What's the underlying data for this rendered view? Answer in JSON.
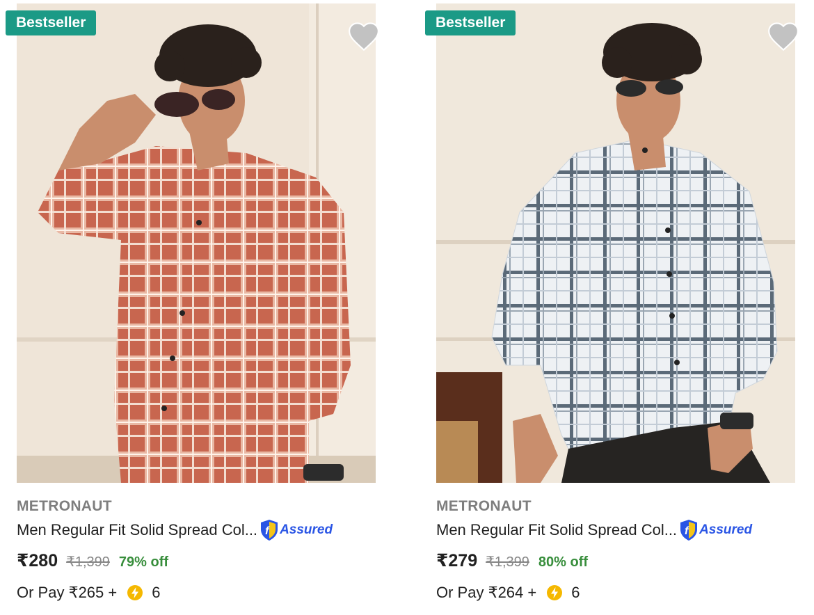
{
  "products": [
    {
      "badge": "Bestseller",
      "brand": "METRONAUT",
      "title": "Men Regular Fit Solid Spread Col...",
      "assured": "Assured",
      "price": "₹280",
      "mrp": "₹1,399",
      "discount": "79% off",
      "pay_prefix": "Or Pay ₹265 +",
      "coins": "6",
      "shirt_color": "#c8664f"
    },
    {
      "badge": "Bestseller",
      "brand": "METRONAUT",
      "title": "Men Regular Fit Solid Spread Col...",
      "assured": "Assured",
      "price": "₹279",
      "mrp": "₹1,399",
      "discount": "80% off",
      "pay_prefix": "Or Pay ₹264 +",
      "coins": "6",
      "shirt_color": "#eef1f4"
    }
  ],
  "colors": {
    "badge": "#1b9a86",
    "discount": "#388e3c",
    "assured": "#2a55e5",
    "coin": "#f5b800"
  }
}
